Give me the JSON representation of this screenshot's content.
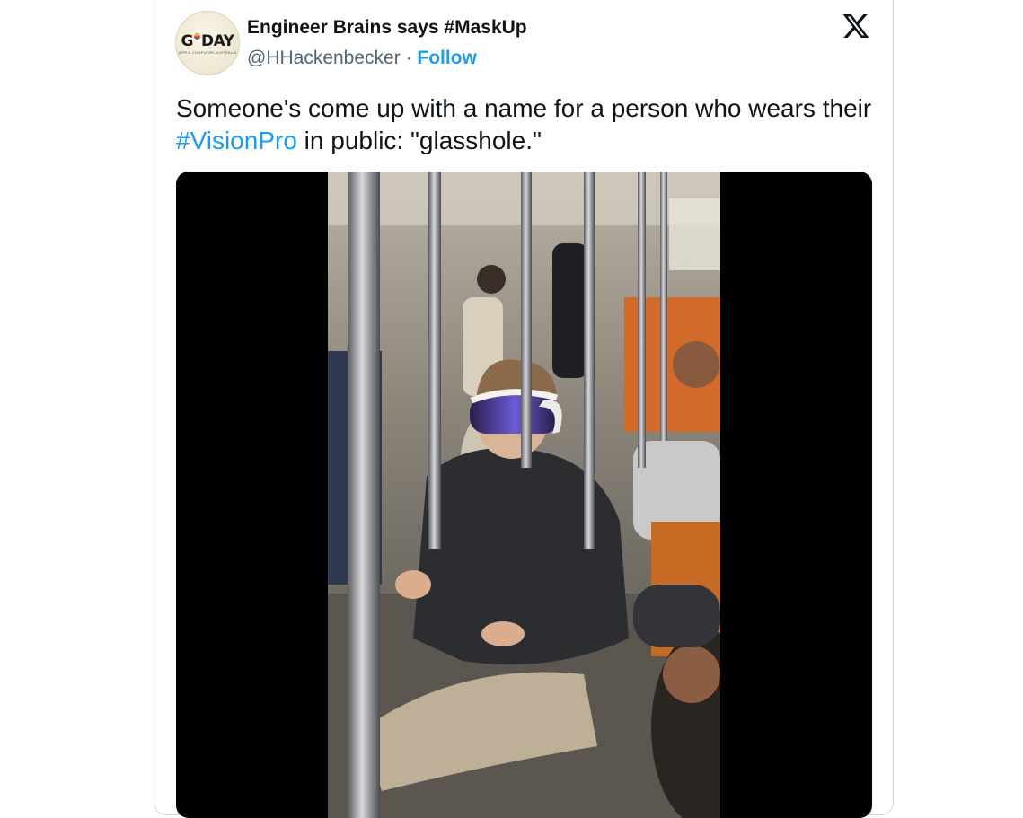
{
  "tweet": {
    "display_name": "Engineer Brains says #MaskUp",
    "handle": "@HHackenbecker",
    "separator": "·",
    "follow_label": "Follow",
    "avatar_logo": {
      "main": "G DAY",
      "sub": "APPLE COMPUTER AUSTRALIA"
    },
    "text_before": "Someone's come up with a name for a person who wears their ",
    "hashtag": "#VisionPro",
    "text_after": " in public: \"glasshole.\""
  },
  "icons": {
    "brand": "x-logo-icon"
  },
  "colors": {
    "link": "#1d9bf0",
    "text": "#0f1419",
    "secondary": "#536471",
    "border": "#cfd9de"
  }
}
